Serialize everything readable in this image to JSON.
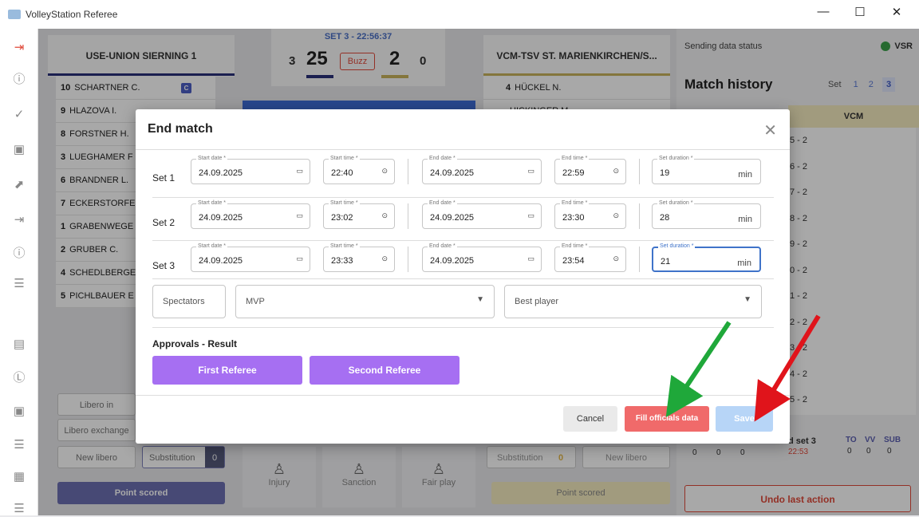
{
  "window": {
    "title": "VolleyStation Referee",
    "minimize": "—",
    "maximize": "☐",
    "close": "✕"
  },
  "team_left": {
    "name": "USE-UNION SIERNING 1",
    "players": [
      {
        "num": "10",
        "name": "SCHARTNER C.",
        "captain": "C"
      },
      {
        "num": "9",
        "name": "HLAZOVA I."
      },
      {
        "num": "8",
        "name": "FORSTNER H."
      },
      {
        "num": "3",
        "name": "LUEGHAMER F"
      },
      {
        "num": "6",
        "name": "BRANDNER L."
      },
      {
        "num": "7",
        "name": "ECKERSTORFE"
      },
      {
        "num": "1",
        "name": "GRABENWEGE"
      },
      {
        "num": "2",
        "name": "GRUBER C."
      },
      {
        "num": "4",
        "name": "SCHEDLBERGE"
      },
      {
        "num": "5",
        "name": "PICHLBAUER E"
      }
    ],
    "libero_in": "Libero in",
    "libero_exchange": "Libero exchange",
    "new_libero": "New libero",
    "substitution": "Substitution",
    "substitution_count": "0",
    "point_scored": "Point scored"
  },
  "team_right": {
    "name": "VCM-TSV ST. MARIENKIRCHEN/S...",
    "players": [
      {
        "num": "4",
        "name": "HÜCKEL N."
      },
      {
        "num": "",
        "name": "HICKINGER M."
      }
    ],
    "substitution": "Substitution",
    "substitution_count": "0",
    "new_libero": "New libero",
    "point_scored": "Point scored"
  },
  "score": {
    "set_label": "SET 3 - 22:56:37",
    "left_sets": "3",
    "left_points": "25",
    "buzz": "Buzz",
    "right_points": "2",
    "right_sets": "0"
  },
  "center_actions": {
    "injury": "Injury",
    "sanction": "Sanction",
    "fair_play": "Fair play"
  },
  "right_panel": {
    "sending_status": "Sending data status",
    "vsr": "VSR",
    "match_history": "Match history",
    "set_label": "Set",
    "set_tabs": [
      "1",
      "2",
      "3"
    ],
    "team_col": "VCM",
    "history": [
      "5 - 2",
      "6 - 2",
      "7 - 2",
      "8 - 2",
      "9 - 2",
      "0 - 2",
      "1 - 2",
      "2 - 2",
      "3 - 2",
      "4 - 2",
      "5 - 2"
    ],
    "end_set": "d set 3",
    "end_time": "22:53",
    "stat_headers": [
      "TO",
      "VV",
      "SUB"
    ],
    "stat_values": [
      "0",
      "0",
      "0"
    ],
    "left_stat_values": [
      "0",
      "0",
      "0"
    ],
    "undo": "Undo last action"
  },
  "dialog": {
    "title": "End match",
    "close": "✕",
    "labels": {
      "start_date": "Start date *",
      "start_time": "Start time *",
      "end_date": "End date *",
      "end_time": "End time *",
      "set_duration": "Set duration *",
      "unit": "min"
    },
    "sets": [
      {
        "label": "Set 1",
        "start_date": "24.09.2025",
        "start_time": "22:40",
        "end_date": "24.09.2025",
        "end_time": "22:59",
        "duration": "19"
      },
      {
        "label": "Set 2",
        "start_date": "24.09.2025",
        "start_time": "23:02",
        "end_date": "24.09.2025",
        "end_time": "23:30",
        "duration": "28"
      },
      {
        "label": "Set 3",
        "start_date": "24.09.2025",
        "start_time": "23:33",
        "end_date": "24.09.2025",
        "end_time": "23:54",
        "duration": "21"
      }
    ],
    "spectators": "Spectators",
    "mvp": "MVP",
    "best_player": "Best player",
    "approvals_title": "Approvals - Result",
    "first_referee": "First Referee",
    "second_referee": "Second Referee",
    "cancel": "Cancel",
    "fill_officials": "Fill officials data",
    "save": "Save"
  },
  "icons": {
    "calendar": "▭",
    "clock": "⊙",
    "dropdown": "▼"
  },
  "colors": {
    "purple": "#a66ff2",
    "red": "#f06a6a",
    "save_disabled": "#b7d5f7",
    "arrow_green": "#1fa83a",
    "arrow_red": "#e0141b"
  }
}
